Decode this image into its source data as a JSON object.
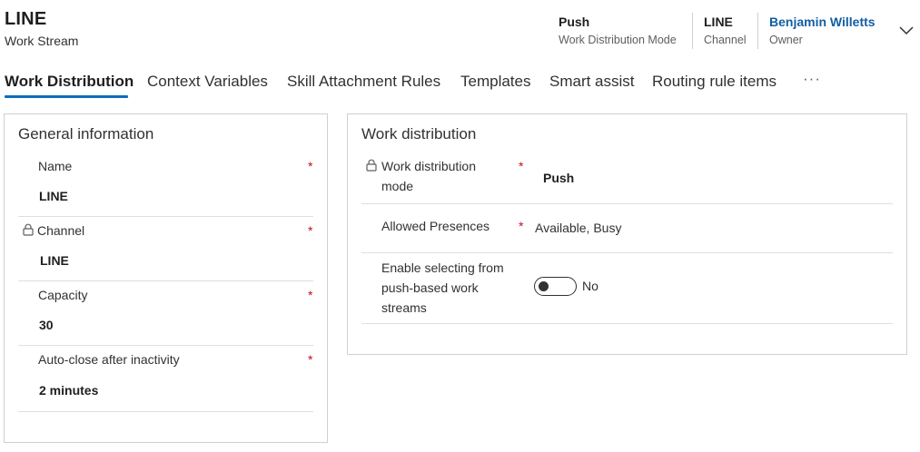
{
  "record": {
    "title": "LINE",
    "entity": "Work Stream"
  },
  "header_fields": [
    {
      "value": "Push",
      "label": "Work Distribution Mode"
    },
    {
      "value": "LINE",
      "label": "Channel"
    },
    {
      "value": "Benjamin Willetts",
      "label": "Owner"
    }
  ],
  "tabs": [
    {
      "label": "Work Distribution",
      "active": true
    },
    {
      "label": "Context Variables"
    },
    {
      "label": "Skill Attachment Rules"
    },
    {
      "label": "Templates"
    },
    {
      "label": "Smart assist"
    },
    {
      "label": "Routing rule items"
    }
  ],
  "tabs_more": "···",
  "general": {
    "title": "General information",
    "fields": [
      {
        "label": "Name",
        "value": "LINE",
        "required": "*"
      },
      {
        "label": "Channel",
        "value": "LINE",
        "required": "*",
        "locked": true
      },
      {
        "label": "Capacity",
        "value": "30",
        "required": "*"
      },
      {
        "label": "Auto-close after inactivity",
        "value": "2 minutes",
        "required": "*"
      }
    ]
  },
  "distribution": {
    "title": "Work distribution",
    "fields": [
      {
        "label_line1": "Work distribution",
        "label_line2": "mode",
        "value": "Push",
        "required": "*",
        "locked": true
      },
      {
        "label": "Allowed Presences",
        "value": "Available, Busy",
        "required": "*"
      },
      {
        "label_line1": "Enable selecting from",
        "label_line2": "push-based work",
        "label_line3": "streams",
        "value": "No",
        "toggle_on": false
      }
    ]
  },
  "colors": {
    "accent": "#0f6cbd",
    "link": "#115ea3",
    "required": "#c50f1f",
    "border": "#d2d0ce"
  },
  "icons": {
    "lock": "lock-icon",
    "expand": "chevron-down-icon",
    "more": "more-icon"
  }
}
